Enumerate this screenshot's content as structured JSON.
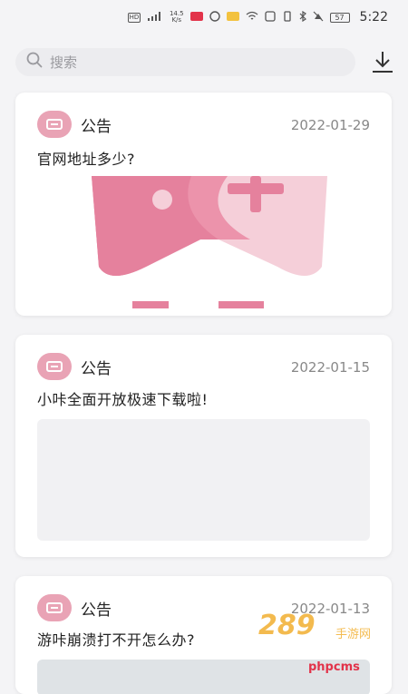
{
  "status_bar": {
    "hd": "HD",
    "net_speed": "14.5\nK/s",
    "battery": "57",
    "time": "5:22"
  },
  "search": {
    "placeholder": "搜索"
  },
  "colors": {
    "accent_pink": "#e9a3b5",
    "card_bg": "#ffffff",
    "page_bg": "#f4f4f6"
  },
  "announcements": [
    {
      "tag": "公告",
      "date": "2022-01-29",
      "title": "官网地址多少?"
    },
    {
      "tag": "公告",
      "date": "2022-01-15",
      "title": "小咔全面开放极速下载啦!"
    },
    {
      "tag": "公告",
      "date": "2022-01-13",
      "title": "游咔崩溃打不开怎么办?"
    }
  ],
  "watermark": {
    "logo": "289",
    "sub": "手游网",
    "cms": "phpcms"
  }
}
